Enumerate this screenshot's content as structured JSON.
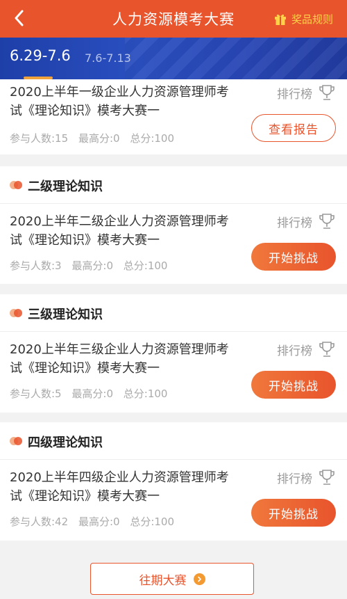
{
  "header": {
    "title": "人力资源模考大赛",
    "rules_label": "奖品规则"
  },
  "tabs": [
    {
      "label": "6.29-7.6",
      "active": true
    },
    {
      "label": "7.6-7.13",
      "active": false
    }
  ],
  "colors": {
    "accent": "#e8542c",
    "tab_bar": "#2a4fc0",
    "gold": "#ffd24a"
  },
  "cards": [
    {
      "category": "",
      "exam_title": "2020上半年一级企业人力资源管理师考试《理论知识》模考大赛一",
      "rank_label": "排行榜",
      "participants": "参与人数:15",
      "high_score": "最高分:0",
      "total_score": "总分:100",
      "action_label": "查看报告",
      "action_type": "report"
    },
    {
      "category": "二级理论知识",
      "exam_title": "2020上半年二级企业人力资源管理师考试《理论知识》模考大赛一",
      "rank_label": "排行榜",
      "participants": "参与人数:3",
      "high_score": "最高分:0",
      "total_score": "总分:100",
      "action_label": "开始挑战",
      "action_type": "start"
    },
    {
      "category": "三级理论知识",
      "exam_title": "2020上半年三级企业人力资源管理师考试《理论知识》模考大赛一",
      "rank_label": "排行榜",
      "participants": "参与人数:5",
      "high_score": "最高分:0",
      "total_score": "总分:100",
      "action_label": "开始挑战",
      "action_type": "start"
    },
    {
      "category": "四级理论知识",
      "exam_title": "2020上半年四级企业人力资源管理师考试《理论知识》模考大赛一",
      "rank_label": "排行榜",
      "participants": "参与人数:42",
      "high_score": "最高分:0",
      "total_score": "总分:100",
      "action_label": "开始挑战",
      "action_type": "start"
    }
  ],
  "footer": {
    "history_label": "往期大赛"
  }
}
